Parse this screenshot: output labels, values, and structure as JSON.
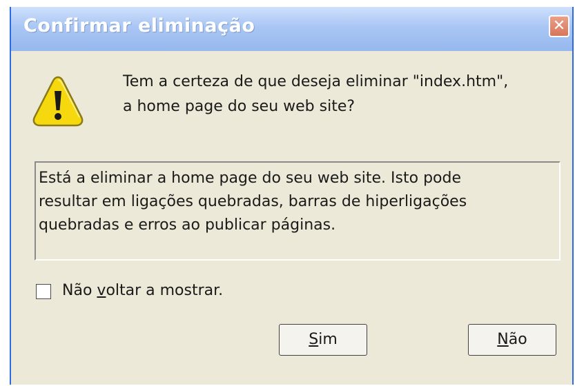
{
  "window": {
    "title": "Confirmar eliminação",
    "close_glyph": "✕"
  },
  "message": {
    "line1": "Tem a certeza de que deseja eliminar \"index.htm\",",
    "line2": "a home page do seu web site?"
  },
  "info": {
    "line1": "Está a eliminar a home page do seu web site. Isto pode",
    "line2": "resultar em ligações quebradas, barras de hiperligações",
    "line3": "quebradas e erros ao publicar páginas."
  },
  "checkbox": {
    "label_pre": "Não ",
    "label_mnemonic": "v",
    "label_post": "oltar a mostrar.",
    "checked": false
  },
  "buttons": {
    "yes_mnemonic": "S",
    "yes_rest": "im",
    "no_mnemonic": "N",
    "no_rest": "ão"
  },
  "icons": {
    "warning": "warning-icon"
  },
  "colors": {
    "dialog_bg": "#ece9d8",
    "title_bar": "#a9c6f4",
    "warning_yellow": "#f6d80e"
  }
}
